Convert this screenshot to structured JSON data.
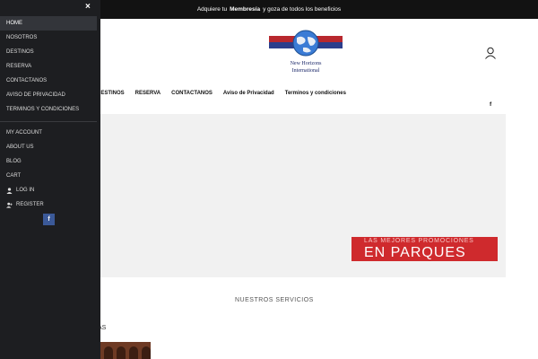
{
  "topbar": {
    "before": "Adquiere tu",
    "bold": "Membresía",
    "after": "y goza de todos los beneficios"
  },
  "header": {
    "logo_line1": "New Horizons",
    "logo_line2": "International"
  },
  "main_nav": [
    {
      "label": "DESTINOS"
    },
    {
      "label": "RESERVA"
    },
    {
      "label": "CONTACTANOS"
    },
    {
      "label": "Aviso de Privacidad"
    },
    {
      "label": "Terminos y condiciones"
    }
  ],
  "social_top": "f",
  "hero": {
    "promo_small": "LAS MEJORES PROMOCIONES",
    "promo_big": "EN PARQUES"
  },
  "section": {
    "services_title": "NUESTROS SERVICIOS",
    "partial_text": "AS"
  },
  "drawer": {
    "close": "×",
    "primary": [
      {
        "label": "HOME"
      },
      {
        "label": "Nosotros"
      },
      {
        "label": "DESTINOS"
      },
      {
        "label": "RESERVA"
      },
      {
        "label": "CONTACTANOS"
      },
      {
        "label": "Aviso de Privacidad"
      },
      {
        "label": "Terminos y condiciones"
      }
    ],
    "secondary": [
      {
        "label": "MY ACCOUNT"
      },
      {
        "label": "ABOUT US"
      },
      {
        "label": "BLOG"
      },
      {
        "label": "CART"
      },
      {
        "label": "LOG IN"
      },
      {
        "label": "REGISTER"
      }
    ],
    "facebook": "f"
  },
  "colors": {
    "promo": "#cf2a2d",
    "drawer_bg": "#1d1e21",
    "facebook": "#3b5998"
  }
}
